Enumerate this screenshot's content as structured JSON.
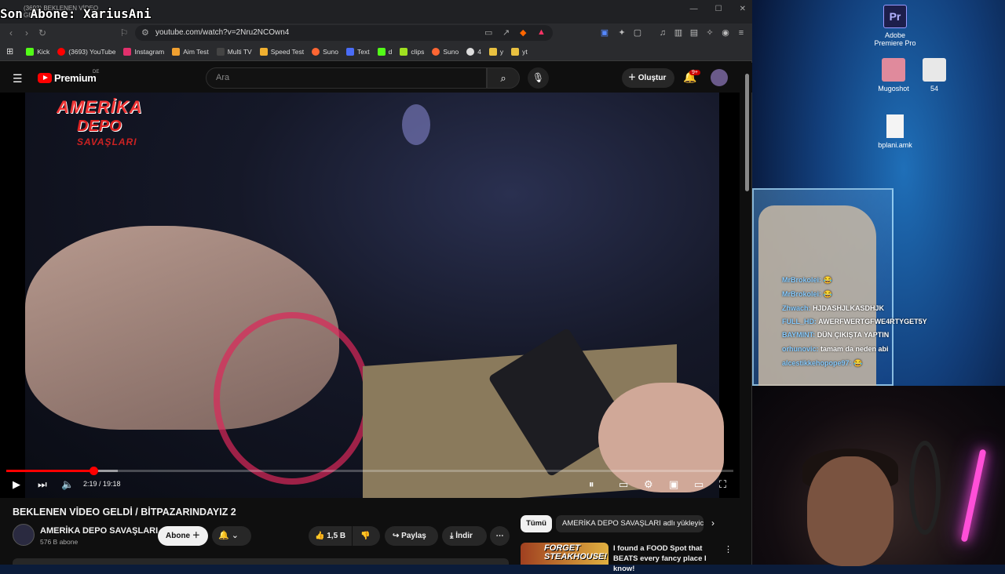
{
  "overlay": {
    "last_subscriber": "Son Abone: XariusAni"
  },
  "browser": {
    "tab_title": "(3693) BEKLENEN VİDEO GEL",
    "url": "youtube.com/watch?v=2Nru2NCOwn4",
    "bookmarks": [
      {
        "label": "Kick",
        "color": "#53fc18"
      },
      {
        "label": "(3693) YouTube",
        "color": "#ff0000"
      },
      {
        "label": "Instagram",
        "color": "#e1306c"
      },
      {
        "label": "Aim Test",
        "color": "#f0a030"
      },
      {
        "label": "Multi TV",
        "color": "#444444"
      },
      {
        "label": "Speed Test",
        "color": "#f0b030"
      },
      {
        "label": "Suno",
        "color": "#ff6633"
      },
      {
        "label": "Text",
        "color": "#4a6cf7"
      },
      {
        "label": "d",
        "color": "#53fc18"
      },
      {
        "label": "clips",
        "color": "#a0e020"
      },
      {
        "label": "Suno",
        "color": "#ff6633"
      },
      {
        "label": "4",
        "color": "#dddddd"
      },
      {
        "label": "y",
        "color": "#e8c040"
      },
      {
        "label": "yt",
        "color": "#e8c040"
      }
    ]
  },
  "youtube": {
    "brand": "Premium",
    "region": "DE",
    "search_placeholder": "Ara",
    "create_label": "Oluştur",
    "notification_count": "9+",
    "player": {
      "time": "2:19 / 19:18",
      "progress_fraction": 0.12,
      "buffer_fraction": 0.153,
      "channel_logo": [
        "AMERİKA",
        "DEPO",
        "SAVAŞLARI"
      ]
    },
    "video_title": "BEKLENEN VİDEO GELDİ / BİTPAZARINDAYIZ 2",
    "channel_name": "AMERİKA DEPO SAVAŞLARI",
    "subscribers": "576 B abone",
    "subscribe_label": "Abone",
    "likes": "1,5 B",
    "share_label": "Paylaş",
    "download_label": "İndir",
    "chips": {
      "all": "Tümü",
      "uploader": "AMERİKA DEPO SAVAŞLARI adlı yükleyici"
    },
    "recommendation": {
      "thumb_text": "FORGET STEAKHOUSE!",
      "title": "I found a FOOD Spot that BEATS every fancy place I know!"
    }
  },
  "desktop": {
    "icons": [
      {
        "label": "Adobe Premiere Pro",
        "glyph": "Pr"
      },
      {
        "label": "Mugoshot"
      },
      {
        "label": "54"
      },
      {
        "label": "bplani.amk"
      }
    ]
  },
  "chat": [
    {
      "user": "MrBrokolei:",
      "msg": "😂"
    },
    {
      "user": "MrBrokolei:",
      "msg": "😂"
    },
    {
      "user": "Zhwach:",
      "msg": "HJDASHJLKASDHJK"
    },
    {
      "user": "FULL_HD:",
      "msg": "AWERFWERTGFWE4RTYGET5Y"
    },
    {
      "user": "BAYMINT:",
      "msg": "DÜN ÇIKIŞTA YAPTIN"
    },
    {
      "user": "orhunovic:",
      "msg": "tamam da neden abi"
    },
    {
      "user": "alcestikkehopope97:",
      "msg": "😂"
    }
  ]
}
